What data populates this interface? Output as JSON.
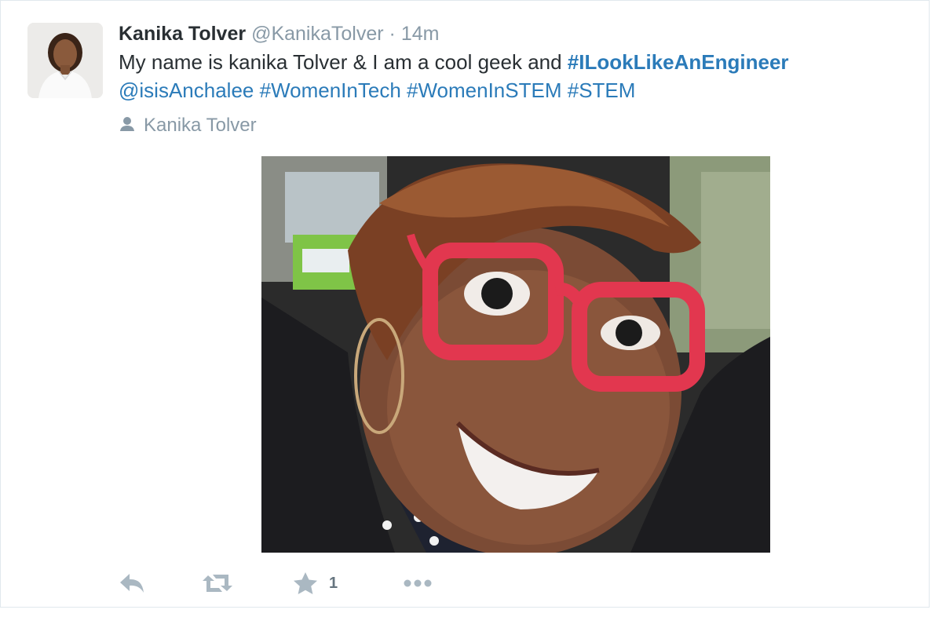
{
  "tweet": {
    "fullname": "Kanika Tolver",
    "username": "@KanikaTolver",
    "separator": "·",
    "timestamp": "14m",
    "text": {
      "part1": "My name is kanika Tolver & I am a cool geek and ",
      "hashtag1": "#ILookLikeAnEngineer",
      "mention": "@isisAnchalee",
      "hashtag2": "#WomenInTech",
      "hashtag3": "#WomenInSTEM",
      "hashtag4": "#STEM"
    },
    "context_label": "Kanika Tolver",
    "context_icon": "person-icon"
  },
  "actions": {
    "reply_icon": "reply-icon",
    "retweet_icon": "retweet-icon",
    "favorite_icon": "star-icon",
    "favorite_count": "1",
    "more_icon": "more-dots-icon"
  },
  "colors": {
    "link": "#2b7bb9",
    "text": "#292f33",
    "muted": "#8899a6",
    "action": "#aab8c2"
  }
}
